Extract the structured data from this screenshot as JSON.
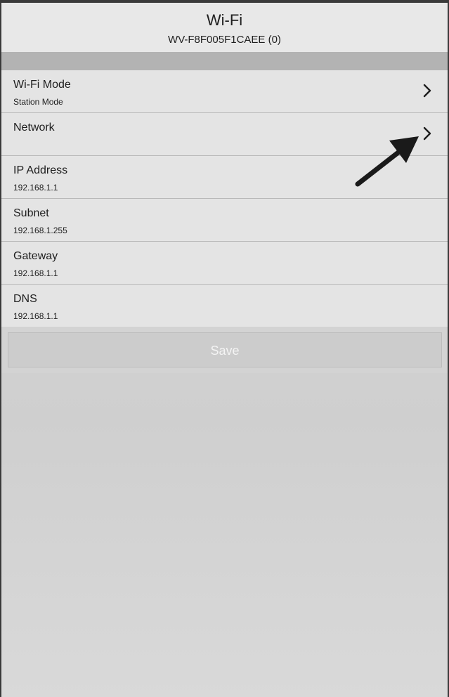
{
  "header": {
    "title": "Wi-Fi",
    "subtitle": "WV-F8F005F1CAEE (0)"
  },
  "settings": [
    {
      "label": "Wi-Fi Mode",
      "value": "Station Mode",
      "has_chevron": true
    },
    {
      "label": "Network",
      "value": "",
      "has_chevron": true
    },
    {
      "label": "IP Address",
      "value": "192.168.1.1",
      "has_chevron": false
    },
    {
      "label": "Subnet",
      "value": "192.168.1.255",
      "has_chevron": false
    },
    {
      "label": "Gateway",
      "value": "192.168.1.1",
      "has_chevron": false
    },
    {
      "label": "DNS",
      "value": "192.168.1.1",
      "has_chevron": false
    }
  ],
  "save": {
    "label": "Save",
    "enabled": false
  },
  "colors": {
    "row_background": "#e4e4e4",
    "section_bar": "#b3b3b3",
    "page_background": "#d6d6d6",
    "text": "#1e1e1e"
  },
  "icons": {
    "chevron": "chevron-right-icon",
    "annotation": "pointer-arrow-icon"
  }
}
